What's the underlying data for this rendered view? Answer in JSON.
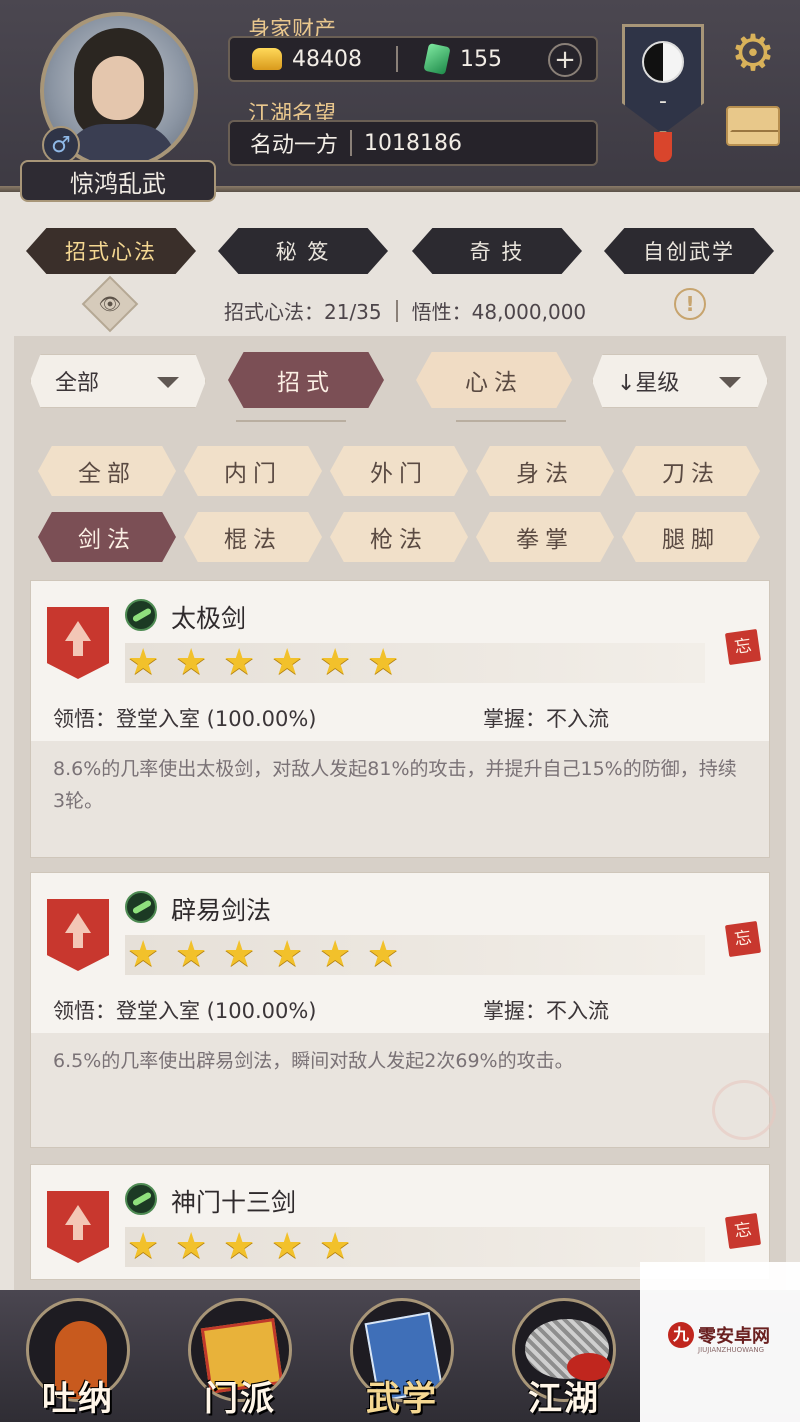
{
  "player": {
    "name": "惊鸿乱武",
    "gender_symbol": "♂"
  },
  "wealth": {
    "label": "身家财产",
    "gold": "48408",
    "jade": "155",
    "add_symbol": "+"
  },
  "reputation": {
    "label": "江湖名望",
    "title": "名动一方",
    "value": "1018186"
  },
  "sect_badge": {
    "value": "-"
  },
  "top_tabs": [
    {
      "label": "招式心法",
      "active": true
    },
    {
      "label": "秘 笈",
      "active": false
    },
    {
      "label": "奇 技",
      "active": false
    },
    {
      "label": "自创武学",
      "active": false
    }
  ],
  "stats": {
    "moves": "招式心法：21/35",
    "insight": "悟性：48,000,000",
    "info_symbol": "!"
  },
  "filters": {
    "scope": "全部",
    "type_tabs": [
      {
        "label": "招式",
        "active": true
      },
      {
        "label": "心法",
        "active": false
      }
    ],
    "sort": "↓星级"
  },
  "categories": [
    {
      "label": "全部",
      "active": false
    },
    {
      "label": "内门",
      "active": false
    },
    {
      "label": "外门",
      "active": false
    },
    {
      "label": "身法",
      "active": false
    },
    {
      "label": "刀法",
      "active": false
    },
    {
      "label": "剑法",
      "active": true
    },
    {
      "label": "棍法",
      "active": false
    },
    {
      "label": "枪法",
      "active": false
    },
    {
      "label": "拳掌",
      "active": false
    },
    {
      "label": "腿脚",
      "active": false
    }
  ],
  "skills": [
    {
      "name": "太极剑",
      "stars": 6,
      "comprehension": "领悟：登堂入室 (100.00%)",
      "mastery": "掌握：不入流",
      "description": "8.6%的几率使出太极剑，对敌人发起81%的攻击，并提升自己15%的防御，持续3轮。",
      "forget_label": "忘"
    },
    {
      "name": "辟易剑法",
      "stars": 6,
      "comprehension": "领悟：登堂入室 (100.00%)",
      "mastery": "掌握：不入流",
      "description": "6.5%的几率使出辟易剑法，瞬间对敌人发起2次69%的攻击。",
      "forget_label": "忘"
    },
    {
      "name": "神门十三剑",
      "stars": 5,
      "forget_label": "忘"
    }
  ],
  "bottom_nav": [
    {
      "label": "吐纳",
      "active": false
    },
    {
      "label": "门派",
      "active": false
    },
    {
      "label": "武学",
      "active": true
    },
    {
      "label": "江湖",
      "active": false
    }
  ],
  "watermark": {
    "logo": "九",
    "text": "零安卓网",
    "sub": "JIUJIANZHUOWANG"
  },
  "icons": {
    "settings": "gear-icon",
    "mail": "mail-icon",
    "sect": "taiji-icon",
    "gold": "gold-ingot-icon",
    "jade": "jade-icon",
    "eye": "eye-icon"
  },
  "colors": {
    "header_bg": "#3d3a43",
    "accent_gold": "#e9c78d",
    "active_pill": "#7b4f55",
    "inactive_pill": "#f0dcc4",
    "badge_red": "#c8372e",
    "star": "#f2c12b"
  }
}
